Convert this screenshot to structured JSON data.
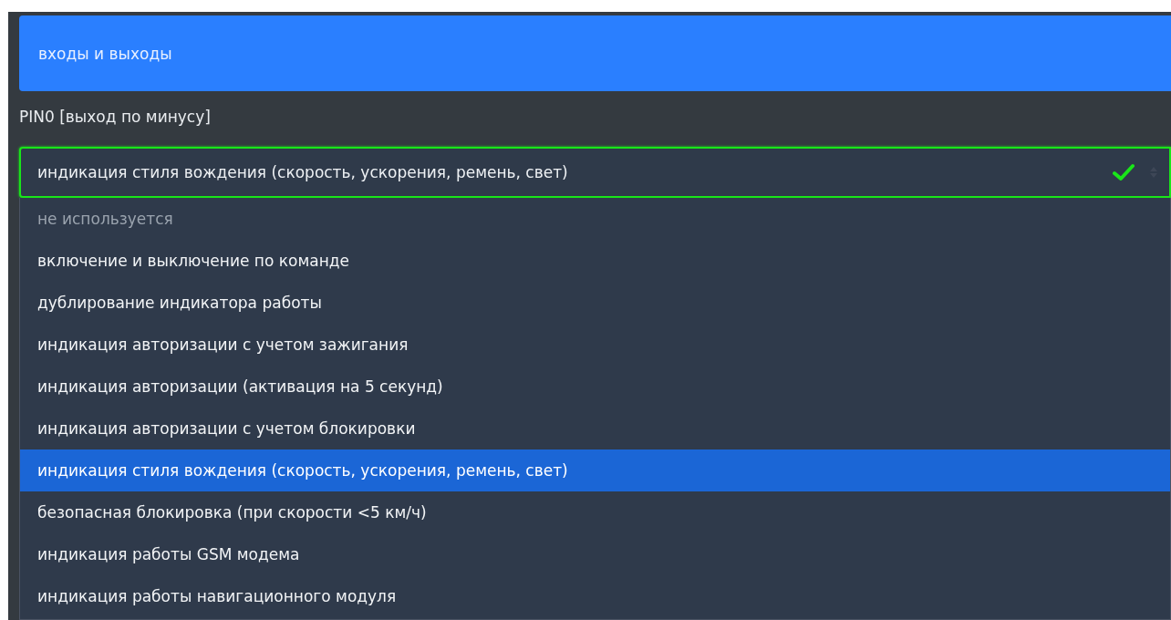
{
  "header": {
    "title": "входы и выходы"
  },
  "field": {
    "label": "PIN0 [выход по минусу]",
    "value": "индикация стиля вождения (скорость, ускорения, ремень, свет)",
    "valid": true
  },
  "options": [
    {
      "label": "не используется",
      "disabled": true,
      "selected": false
    },
    {
      "label": "включение и выключение по команде",
      "disabled": false,
      "selected": false
    },
    {
      "label": "дублирование индикатора работы",
      "disabled": false,
      "selected": false
    },
    {
      "label": "индикация авторизации с учетом зажигания",
      "disabled": false,
      "selected": false
    },
    {
      "label": "индикация авторизации (активация на 5 секунд)",
      "disabled": false,
      "selected": false
    },
    {
      "label": "индикация авторизации с учетом блокировки",
      "disabled": false,
      "selected": false
    },
    {
      "label": "индикация стиля вождения (скорость, ускорения, ремень, свет)",
      "disabled": false,
      "selected": true
    },
    {
      "label": "безопасная блокировка (при скорости <5 км/ч)",
      "disabled": false,
      "selected": false
    },
    {
      "label": "индикация работы GSM модема",
      "disabled": false,
      "selected": false
    },
    {
      "label": "индикация работы навигационного модуля",
      "disabled": false,
      "selected": false
    }
  ]
}
